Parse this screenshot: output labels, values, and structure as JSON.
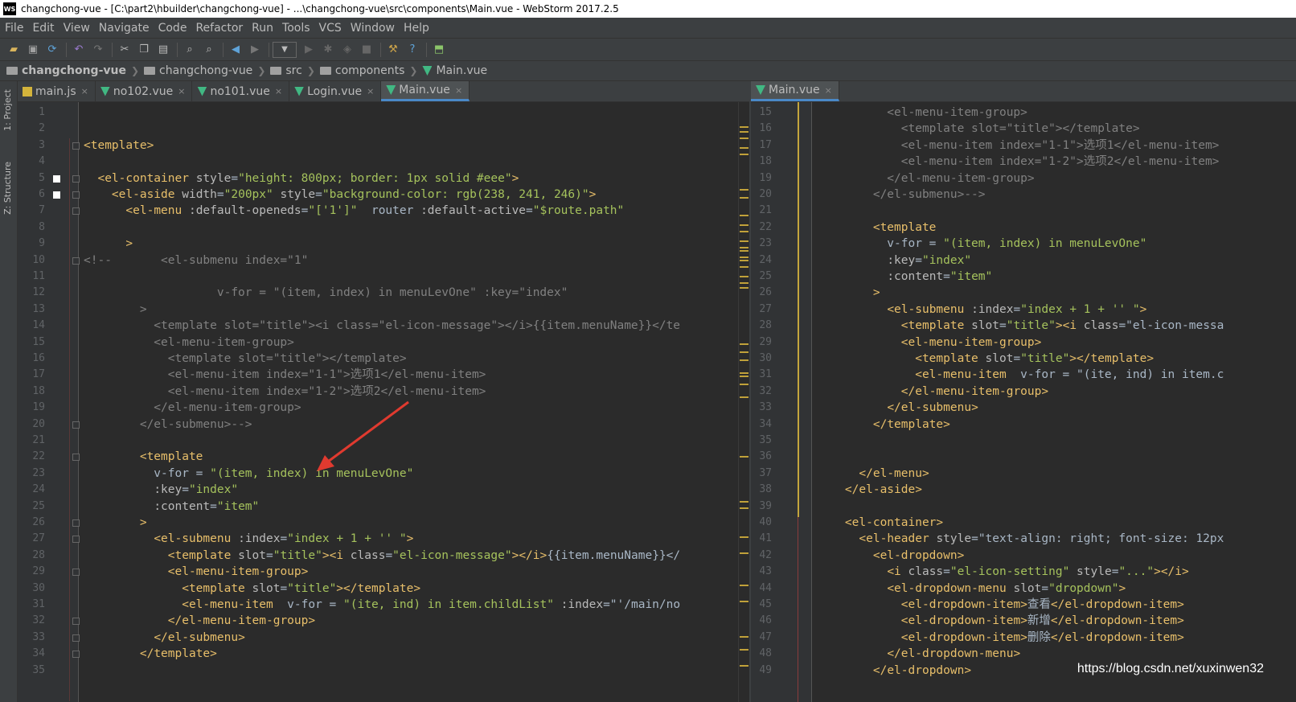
{
  "window": {
    "title": "changchong-vue - [C:\\part2\\hbuilder\\changchong-vue] - ...\\changchong-vue\\src\\components\\Main.vue - WebStorm 2017.2.5",
    "logo_text": "WS"
  },
  "menu": [
    "File",
    "Edit",
    "View",
    "Navigate",
    "Code",
    "Refactor",
    "Run",
    "Tools",
    "VCS",
    "Window",
    "Help"
  ],
  "toolbar": {
    "icons": [
      "open-folder-icon",
      "save-icon",
      "sync-icon",
      "undo-icon",
      "redo-icon",
      "cut-icon",
      "copy-icon",
      "paste-icon",
      "find-icon",
      "replace-icon",
      "back-icon",
      "forward-icon",
      "run-config-dropdown",
      "run-icon",
      "debug-icon",
      "coverage-icon",
      "stop-icon",
      "project-structure-icon",
      "help-icon",
      "vcs-icon"
    ]
  },
  "breadcrumb": [
    {
      "label": "changchong-vue",
      "kind": "folder",
      "bold": true
    },
    {
      "label": "changchong-vue",
      "kind": "folder"
    },
    {
      "label": "src",
      "kind": "folder"
    },
    {
      "label": "components",
      "kind": "folder"
    },
    {
      "label": "Main.vue",
      "kind": "vue"
    }
  ],
  "left_strip": {
    "project": "1: Project",
    "structure": "Z: Structure"
  },
  "left_tabs": [
    {
      "label": "main.js",
      "kind": "js",
      "active": false
    },
    {
      "label": "no102.vue",
      "kind": "vue",
      "active": false
    },
    {
      "label": "no101.vue",
      "kind": "vue",
      "active": false
    },
    {
      "label": "Login.vue",
      "kind": "vue",
      "active": false
    },
    {
      "label": "Main.vue",
      "kind": "vue",
      "active": true
    }
  ],
  "right_tabs": [
    {
      "label": "Main.vue",
      "kind": "vue",
      "active": true
    }
  ],
  "tab_close_glyph": "×",
  "left_editor": {
    "first_line": 1,
    "line_numbers": [
      "1",
      "2",
      "3",
      "4",
      "5",
      "6",
      "7",
      "8",
      "9",
      "10",
      "11",
      "12",
      "13",
      "14",
      "15",
      "16",
      "17",
      "18",
      "19",
      "20",
      "21",
      "22",
      "23",
      "24",
      "25",
      "26",
      "27",
      "28",
      "29",
      "30",
      "31",
      "32",
      "33",
      "34",
      "35"
    ],
    "lines": [
      "",
      "",
      "<template>",
      "",
      "  <el-container style=\"height: 800px; border: 1px solid #eee\">",
      "    <el-aside width=\"200px\" style=\"background-color: rgb(238, 241, 246)\">",
      "      <el-menu :default-openeds=\"['1']\"  router :default-active=\"$route.path\"",
      "",
      "      >",
      "<!--       <el-submenu index=\"1\"",
      "",
      "                   v-for = \"(item, index) in menuLevOne\" :key=\"index\"",
      "        >",
      "          <template slot=\"title\"><i class=\"el-icon-message\"></i>{{item.menuName}}</te",
      "          <el-menu-item-group>",
      "            <template slot=\"title\"></template>",
      "            <el-menu-item index=\"1-1\">选项1</el-menu-item>",
      "            <el-menu-item index=\"1-2\">选项2</el-menu-item>",
      "          </el-menu-item-group>",
      "        </el-submenu>-->",
      "",
      "        <template",
      "          v-for = \"(item, index) in menuLevOne\"",
      "          :key=\"index\"",
      "          :content=\"item\"",
      "        >",
      "          <el-submenu :index=\"index + 1 + '' \">",
      "            <template slot=\"title\"><i class=\"el-icon-message\"></i>{{item.menuName}}</",
      "            <el-menu-item-group>",
      "              <template slot=\"title\"></template>",
      "              <el-menu-item  v-for = \"(ite, ind) in item.childList\" :index=\"'/main/no",
      "            </el-menu-item-group>",
      "          </el-submenu>",
      "        </template>",
      ""
    ]
  },
  "right_editor": {
    "line_numbers": [
      "15",
      "16",
      "17",
      "18",
      "19",
      "20",
      "21",
      "22",
      "23",
      "24",
      "25",
      "26",
      "27",
      "28",
      "29",
      "30",
      "31",
      "32",
      "33",
      "34",
      "35",
      "36",
      "37",
      "38",
      "39",
      "40",
      "41",
      "42",
      "43",
      "44",
      "45",
      "46",
      "47",
      "48",
      "49"
    ],
    "lines": [
      "          <el-menu-item-group>",
      "            <template slot=\"title\"></template>",
      "            <el-menu-item index=\"1-1\">选项1</el-menu-item>",
      "            <el-menu-item index=\"1-2\">选项2</el-menu-item>",
      "          </el-menu-item-group>",
      "        </el-submenu>-->",
      "",
      "        <template",
      "          v-for = \"(item, index) in menuLevOne\"",
      "          :key=\"index\"",
      "          :content=\"item\"",
      "        >",
      "          <el-submenu :index=\"index + 1 + '' \">",
      "            <template slot=\"title\"><i class=\"el-icon-messa",
      "            <el-menu-item-group>",
      "              <template slot=\"title\"></template>",
      "              <el-menu-item  v-for = \"(ite, ind) in item.c",
      "            </el-menu-item-group>",
      "          </el-submenu>",
      "        </template>",
      "",
      "",
      "      </el-menu>",
      "    </el-aside>",
      "",
      "    <el-container>",
      "      <el-header style=\"text-align: right; font-size: 12px",
      "        <el-dropdown>",
      "          <i class=\"el-icon-setting\" style=\"...\"></i>",
      "          <el-dropdown-menu slot=\"dropdown\">",
      "            <el-dropdown-item>查看</el-dropdown-item>",
      "            <el-dropdown-item>新增</el-dropdown-item>",
      "            <el-dropdown-item>删除</el-dropdown-item>",
      "          </el-dropdown-menu>",
      "        </el-dropdown>"
    ]
  },
  "watermark": "https://blog.csdn.net/xuxinwen32",
  "colors": {
    "tag": "#e8bf6a",
    "string": "#a5c25c",
    "attr": "#bababa",
    "comment": "#808080",
    "number": "#6897bb",
    "ident": "#9876aa",
    "accent": "#4a88c7"
  }
}
